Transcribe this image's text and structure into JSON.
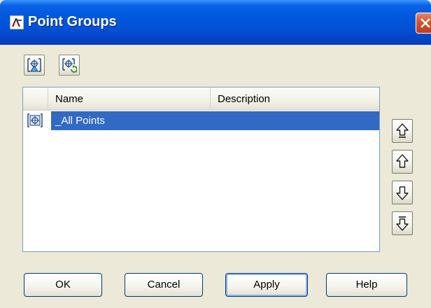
{
  "window": {
    "title": "Point Groups",
    "title_icon": "civil3d-app-icon",
    "accent": "#0058dc"
  },
  "toolbar": {
    "buttons": [
      {
        "name": "point-group-properties",
        "icon": "point-group-properties-icon"
      },
      {
        "name": "update-point-groups",
        "icon": "update-point-groups-icon"
      }
    ]
  },
  "list": {
    "columns": [
      {
        "label": "Name"
      },
      {
        "label": "Description"
      }
    ],
    "rows": [
      {
        "name": "_All Points",
        "description": "",
        "icon": "point-group-icon",
        "selected": true
      }
    ],
    "selection_color": "#316ac5"
  },
  "order_buttons": [
    {
      "name": "move-to-top",
      "icon": "move-to-top-icon"
    },
    {
      "name": "move-up",
      "icon": "arrow-up-icon"
    },
    {
      "name": "move-down",
      "icon": "arrow-down-icon"
    },
    {
      "name": "move-to-bottom",
      "icon": "move-to-bottom-icon"
    }
  ],
  "footer": {
    "ok_label": "OK",
    "cancel_label": "Cancel",
    "apply_label": "Apply",
    "help_label": "Help"
  }
}
